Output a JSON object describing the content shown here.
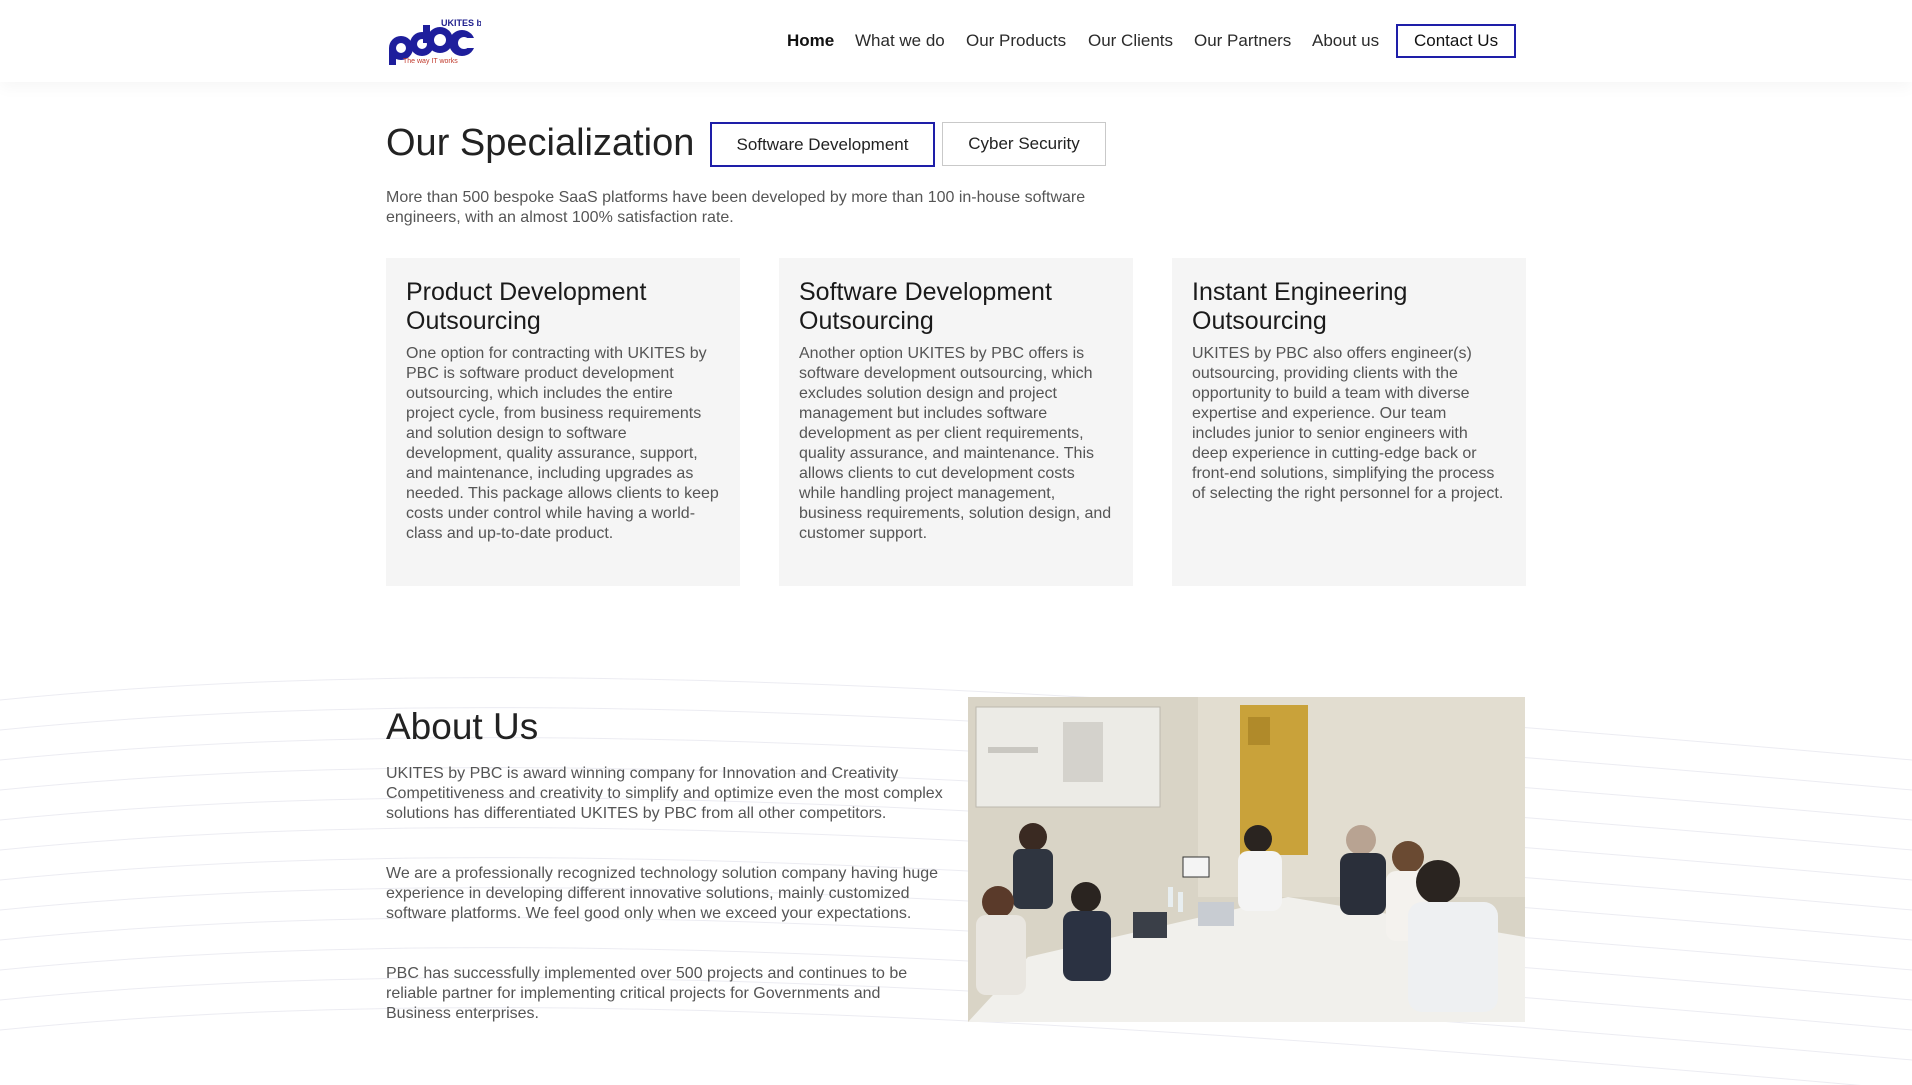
{
  "logo": {
    "brand_small": "UKITES by",
    "brand_big": "pbc",
    "tagline": "The way IT works"
  },
  "nav": {
    "items": [
      "Home",
      "What we do",
      "Our Products",
      "Our Clients",
      "Our Partners",
      "About us"
    ],
    "contact": "Contact Us",
    "active": "Home"
  },
  "specialization": {
    "title": "Our Specialization",
    "tabs": [
      "Software Development",
      "Cyber Security"
    ],
    "active_tab": "Software Development",
    "description": "More than 500 bespoke SaaS platforms have been developed by more than 100 in-house software engineers, with an almost 100% satisfaction rate.",
    "cards": [
      {
        "title": "Product Development Outsourcing",
        "text": "One option for contracting with UKITES by PBC is software product development outsourcing, which includes the entire project cycle, from business requirements and solution design to software development, quality assurance, support, and maintenance, including upgrades as needed. This package allows clients to keep costs under control while having a world-class and up-to-date product."
      },
      {
        "title": "Software Development Outsourcing",
        "text": "Another option UKITES by PBC offers is software development outsourcing, which excludes solution design and project management but includes software development as per client requirements, quality assurance, and maintenance. This allows clients to cut development costs while handling project management, business requirements, solution design, and customer support."
      },
      {
        "title": "Instant Engineering Outsourcing",
        "text": "UKITES by PBC also offers engineer(s) outsourcing, providing clients with the opportunity to build a team with diverse expertise and experience. Our team includes junior to senior engineers with deep experience in cutting-edge back or front-end solutions, simplifying the process of selecting the right personnel for a project."
      }
    ]
  },
  "about": {
    "title": "About Us",
    "paragraphs": [
      "UKITES by PBC is award winning company for Innovation and Creativity Competitiveness and creativity to simplify and optimize even the most complex solutions has differentiated UKITES by PBC from all other competitors.",
      "We are a professionally recognized technology solution company having huge experience in developing different innovative solutions, mainly customized software platforms. We feel good only when we exceed your expectations.",
      "PBC has successfully implemented over 500 projects and continues to be reliable partner for implementing critical projects for Governments and Business enterprises."
    ]
  },
  "colors": {
    "accent": "#1e1ea8",
    "card_bg": "#f5f5f5",
    "text": "#555555",
    "heading": "#222222"
  }
}
